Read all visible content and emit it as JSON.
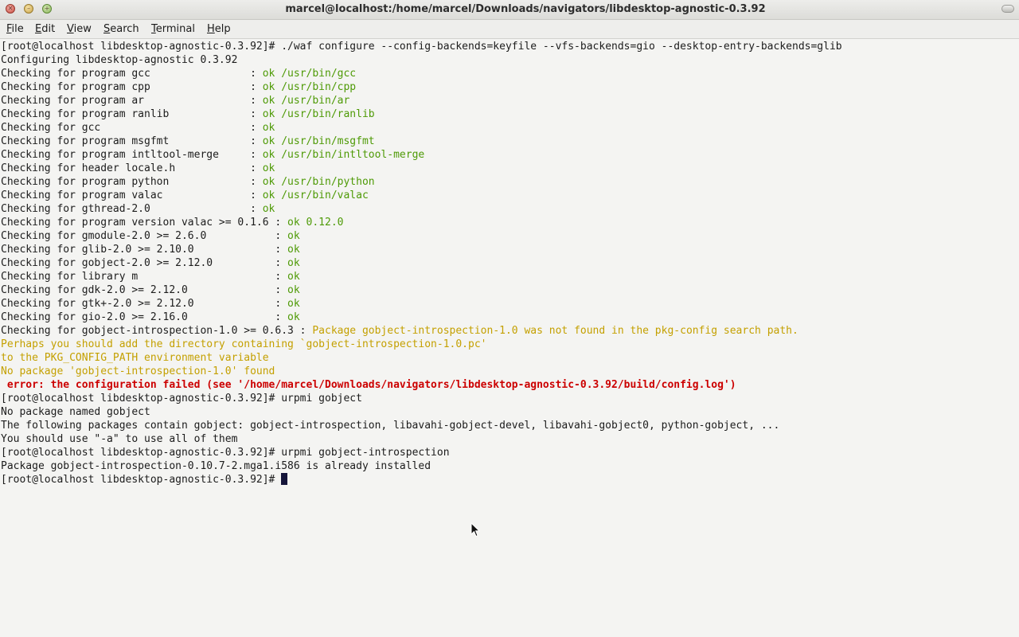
{
  "window": {
    "title": "marcel@localhost:/home/marcel/Downloads/navigators/libdesktop-agnostic-0.3.92"
  },
  "menubar": {
    "file": {
      "mn": "F",
      "rest": "ile"
    },
    "edit": {
      "mn": "E",
      "rest": "dit"
    },
    "view": {
      "mn": "V",
      "rest": "iew"
    },
    "search": {
      "mn": "S",
      "rest": "earch"
    },
    "terminal": {
      "mn": "T",
      "rest": "erminal"
    },
    "help": {
      "mn": "H",
      "rest": "elp"
    }
  },
  "colors": {
    "ok": "#4e9a06",
    "warning": "#c4a000",
    "error": "#cc0000",
    "background": "#f4f4f2",
    "cursor": "#15153a"
  },
  "terminal": {
    "prompt": "[root@localhost libdesktop-agnostic-0.3.92]# ",
    "cmd1": "./waf configure --config-backends=keyfile --vfs-backends=gio --desktop-entry-backends=glib",
    "configuring": "Configuring libdesktop-agnostic 0.3.92",
    "checks": [
      {
        "label": "Checking for program gcc                : ",
        "result": "ok /usr/bin/gcc"
      },
      {
        "label": "Checking for program cpp                : ",
        "result": "ok /usr/bin/cpp"
      },
      {
        "label": "Checking for program ar                 : ",
        "result": "ok /usr/bin/ar"
      },
      {
        "label": "Checking for program ranlib             : ",
        "result": "ok /usr/bin/ranlib"
      },
      {
        "label": "Checking for gcc                        : ",
        "result": "ok"
      },
      {
        "label": "Checking for program msgfmt             : ",
        "result": "ok /usr/bin/msgfmt"
      },
      {
        "label": "Checking for program intltool-merge     : ",
        "result": "ok /usr/bin/intltool-merge"
      },
      {
        "label": "Checking for header locale.h            : ",
        "result": "ok"
      },
      {
        "label": "Checking for program python             : ",
        "result": "ok /usr/bin/python"
      },
      {
        "label": "Checking for program valac              : ",
        "result": "ok /usr/bin/valac"
      },
      {
        "label": "Checking for gthread-2.0                : ",
        "result": "ok"
      },
      {
        "label": "Checking for program version valac >= 0.1.6 : ",
        "result": "ok 0.12.0"
      },
      {
        "label": "Checking for gmodule-2.0 >= 2.6.0           : ",
        "result": "ok"
      },
      {
        "label": "Checking for glib-2.0 >= 2.10.0             : ",
        "result": "ok"
      },
      {
        "label": "Checking for gobject-2.0 >= 2.12.0          : ",
        "result": "ok"
      },
      {
        "label": "Checking for library m                      : ",
        "result": "ok"
      },
      {
        "label": "Checking for gdk-2.0 >= 2.12.0              : ",
        "result": "ok"
      },
      {
        "label": "Checking for gtk+-2.0 >= 2.12.0             : ",
        "result": "ok"
      },
      {
        "label": "Checking for gio-2.0 >= 2.16.0              : ",
        "result": "ok"
      }
    ],
    "gi_check": {
      "label": "Checking for gobject-introspection-1.0 >= 0.6.3 : ",
      "result": "Package gobject-introspection-1.0 was not found in the pkg-config search path."
    },
    "warn_lines": [
      "Perhaps you should add the directory containing `gobject-introspection-1.0.pc'",
      "to the PKG_CONFIG_PATH environment variable",
      "No package 'gobject-introspection-1.0' found"
    ],
    "error_line": " error: the configuration failed (see '/home/marcel/Downloads/navigators/libdesktop-agnostic-0.3.92/build/config.log')",
    "cmd2": "urpmi gobject",
    "out2": [
      "No package named gobject",
      "The following packages contain gobject: gobject-introspection, libavahi-gobject-devel, libavahi-gobject0, python-gobject, ...",
      "You should use \"-a\" to use all of them"
    ],
    "cmd3": "urpmi gobject-introspection",
    "out3": "Package gobject-introspection-0.10.7-2.mga1.i586 is already installed"
  }
}
